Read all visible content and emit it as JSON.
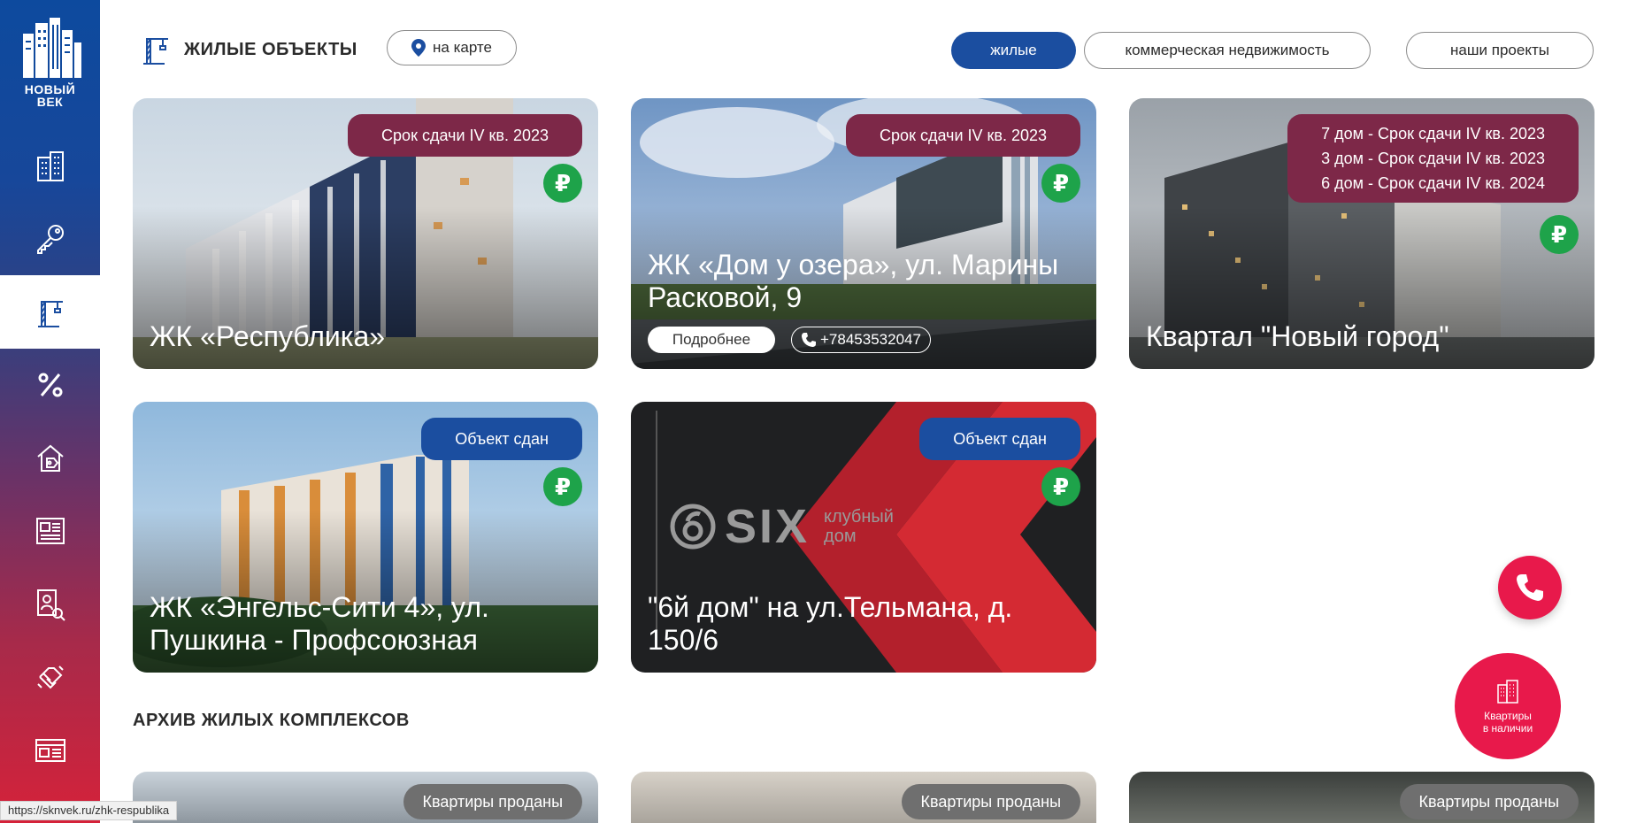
{
  "brand": {
    "logo_line1": "НОВЫЙ",
    "logo_line2": "ВЕК"
  },
  "header": {
    "title": "ЖИЛЫЕ ОБЪЕКТЫ",
    "map_button": "на карте"
  },
  "filters": [
    {
      "label": "жилые",
      "active": true
    },
    {
      "label": "коммерческая недвижимость",
      "active": false
    },
    {
      "label": "наши проекты",
      "active": false
    }
  ],
  "sidebar": {
    "items": [
      {
        "icon": "buildings-icon"
      },
      {
        "icon": "key-icon"
      },
      {
        "icon": "crane-icon",
        "active": true
      },
      {
        "icon": "percent-icon"
      },
      {
        "icon": "house-tag-icon"
      },
      {
        "icon": "news-icon"
      },
      {
        "icon": "profile-search-icon"
      },
      {
        "icon": "handshake-icon"
      },
      {
        "icon": "newspaper-icon"
      }
    ]
  },
  "cards": [
    {
      "title": "ЖК «Республика»",
      "badge": [
        "Срок сдачи IV кв. 2023"
      ],
      "badge_color": "#7d2848"
    },
    {
      "title": "ЖК «Дом у озера», ул. Марины Расковой, 9",
      "badge": [
        "Срок сдачи IV кв. 2023"
      ],
      "badge_color": "#7d2848",
      "more": "Подробнее",
      "phone": "+78453532047"
    },
    {
      "title": "Квартал \"Новый город\"",
      "badge": [
        "7 дом - Срок сдачи IV кв. 2023",
        "3 дом - Срок сдачи IV кв. 2023",
        "6 дом - Срок сдачи IV кв. 2024"
      ],
      "badge_color": "#7d2848"
    },
    {
      "title": "ЖК «Энгельс-Сити 4», ул. Пушкина - Профсоюзная",
      "badge": [
        "Объект сдан"
      ],
      "badge_color": "#1b4ea0"
    },
    {
      "title": "\"6й дом\" на ул.Тельмана, д. 150/6",
      "badge": [
        "Объект сдан"
      ],
      "badge_color": "#1b4ea0",
      "logo_text": "SIX",
      "logo_sub1": "клубный",
      "logo_sub2": "дом"
    }
  ],
  "currency_symbol": "₽",
  "archive": {
    "title": "АРХИВ ЖИЛЫХ КОМПЛЕКСОВ",
    "badges": [
      "Квартиры проданы",
      "Квартиры проданы",
      "Квартиры проданы"
    ]
  },
  "fab": {
    "apartments_line1": "Квартиры",
    "apartments_line2": "в наличии"
  },
  "status_url": "https://sknvek.ru/zhk-respublika"
}
